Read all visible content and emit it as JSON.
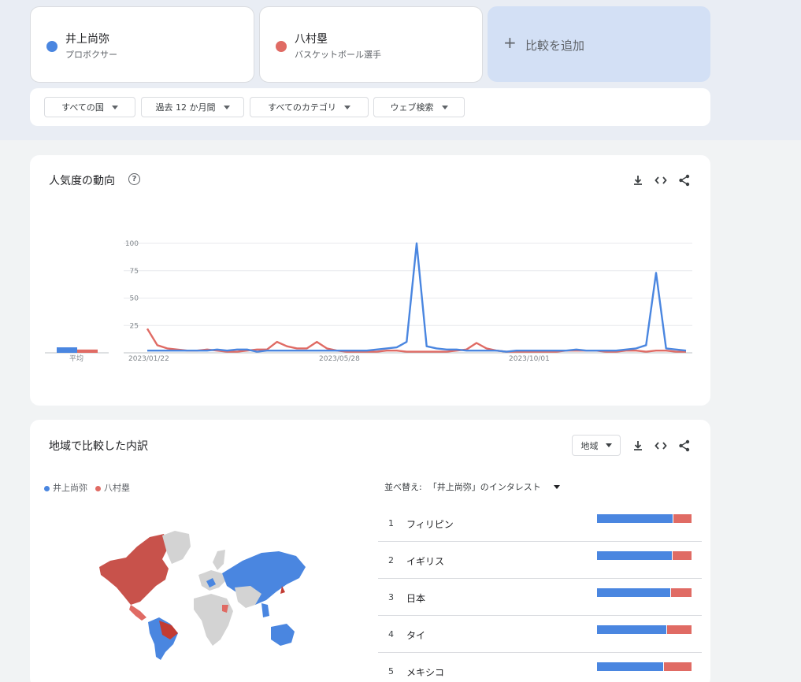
{
  "colors": {
    "blue": "#4a86e0",
    "red": "#e06b64",
    "red_dark": "#c23b33",
    "gray_land": "#d3d3d3"
  },
  "terms": [
    {
      "name": "井上尚弥",
      "subtitle": "プロボクサー",
      "color": "#4a86e0"
    },
    {
      "name": "八村塁",
      "subtitle": "バスケットボール選手",
      "color": "#e06b64"
    }
  ],
  "add_compare": {
    "icon": "plus-icon",
    "label": "比較を追加"
  },
  "filters": [
    {
      "label": "すべての国"
    },
    {
      "label": "過去 12 か月間"
    },
    {
      "label": "すべてのカテゴリ"
    },
    {
      "label": "ウェブ検索"
    }
  ],
  "trend": {
    "title": "人気度の動向",
    "icons": [
      "help-icon",
      "download-icon",
      "embed-icon",
      "share-icon"
    ],
    "average_label": "平均"
  },
  "chart_data": {
    "type": "line",
    "x_ticks": [
      "2023/01/22",
      "2023/05/28",
      "2023/10/01"
    ],
    "y_ticks": [
      25,
      50,
      75,
      100
    ],
    "ylim": [
      0,
      100
    ],
    "x_count": 53,
    "series": [
      {
        "name": "井上尚弥",
        "color": "#4a86e0",
        "values": [
          2,
          2,
          2,
          2,
          2,
          2,
          2,
          3,
          2,
          3,
          3,
          1,
          2,
          2,
          2,
          2,
          2,
          2,
          2,
          2,
          2,
          2,
          2,
          3,
          4,
          5,
          10,
          100,
          6,
          4,
          3,
          3,
          2,
          2,
          2,
          2,
          1,
          2,
          2,
          2,
          2,
          2,
          2,
          3,
          2,
          2,
          2,
          2,
          3,
          4,
          7,
          73,
          4,
          3,
          2
        ],
        "average": 5
      },
      {
        "name": "八村塁",
        "color": "#e06b64",
        "values": [
          22,
          7,
          4,
          3,
          2,
          2,
          3,
          2,
          1,
          1,
          2,
          3,
          3,
          10,
          6,
          4,
          4,
          10,
          4,
          2,
          1,
          1,
          1,
          1,
          2,
          2,
          1,
          1,
          1,
          1,
          1,
          2,
          3,
          9,
          4,
          2,
          1,
          1,
          1,
          1,
          1,
          1,
          2,
          2,
          2,
          2,
          1,
          1,
          2,
          2,
          1,
          2,
          2,
          1,
          1
        ],
        "average": 3
      }
    ]
  },
  "regions": {
    "title": "地域で比較した内訳",
    "select_label": "地域",
    "icons": [
      "download-icon",
      "embed-icon",
      "share-icon"
    ],
    "legend": [
      {
        "name": "井上尚弥",
        "color": "#4a86e0"
      },
      {
        "name": "八村塁",
        "color": "#e06b64"
      }
    ],
    "sort_prefix": "並べ替え:",
    "sort_value": "「井上尚弥」のインタレスト",
    "rows": [
      {
        "rank": "1",
        "name": "フィリピン",
        "blue": 81,
        "red": 19
      },
      {
        "rank": "2",
        "name": "イギリス",
        "blue": 80,
        "red": 20
      },
      {
        "rank": "3",
        "name": "日本",
        "blue": 78,
        "red": 22
      },
      {
        "rank": "4",
        "name": "タイ",
        "blue": 74,
        "red": 26
      },
      {
        "rank": "5",
        "name": "メキシコ",
        "blue": 71,
        "red": 29
      }
    ]
  }
}
